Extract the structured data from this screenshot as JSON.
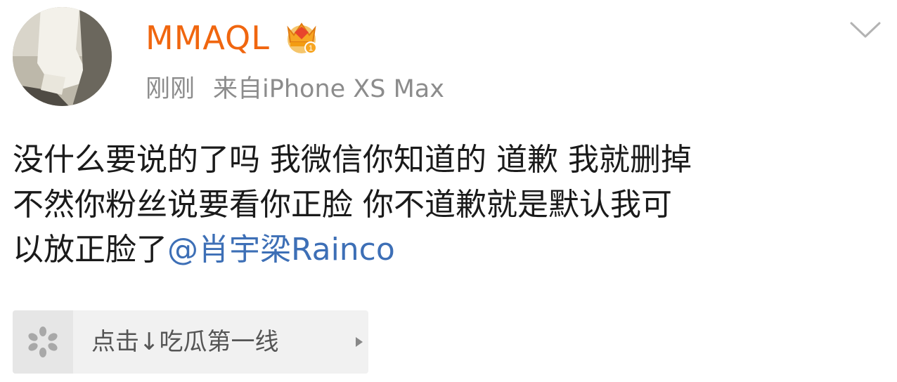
{
  "post": {
    "author": {
      "name": "MMAQL",
      "avatar_icon": "avatar-photo",
      "badge_icon": "vip-crown-icon",
      "name_color": "#f0660f"
    },
    "time": "刚刚",
    "source": "来自iPhone XS Max",
    "menu_icon": "chevron-down-icon",
    "text": {
      "line1": "没什么要说的了吗  我微信你知道的 道歉 我就删掉",
      "line2": "不然你粉丝说要看你正脸 你不道歉就是默认我可",
      "line3_prefix": "以放正脸了",
      "mention": "@肖宇梁Rainco"
    },
    "mention_color": "#3d6fb6"
  },
  "topic_card": {
    "icon": "flower-loading-icon",
    "label": "点击↓吃瓜第一线",
    "arrow_icon": "play-arrow-icon"
  }
}
